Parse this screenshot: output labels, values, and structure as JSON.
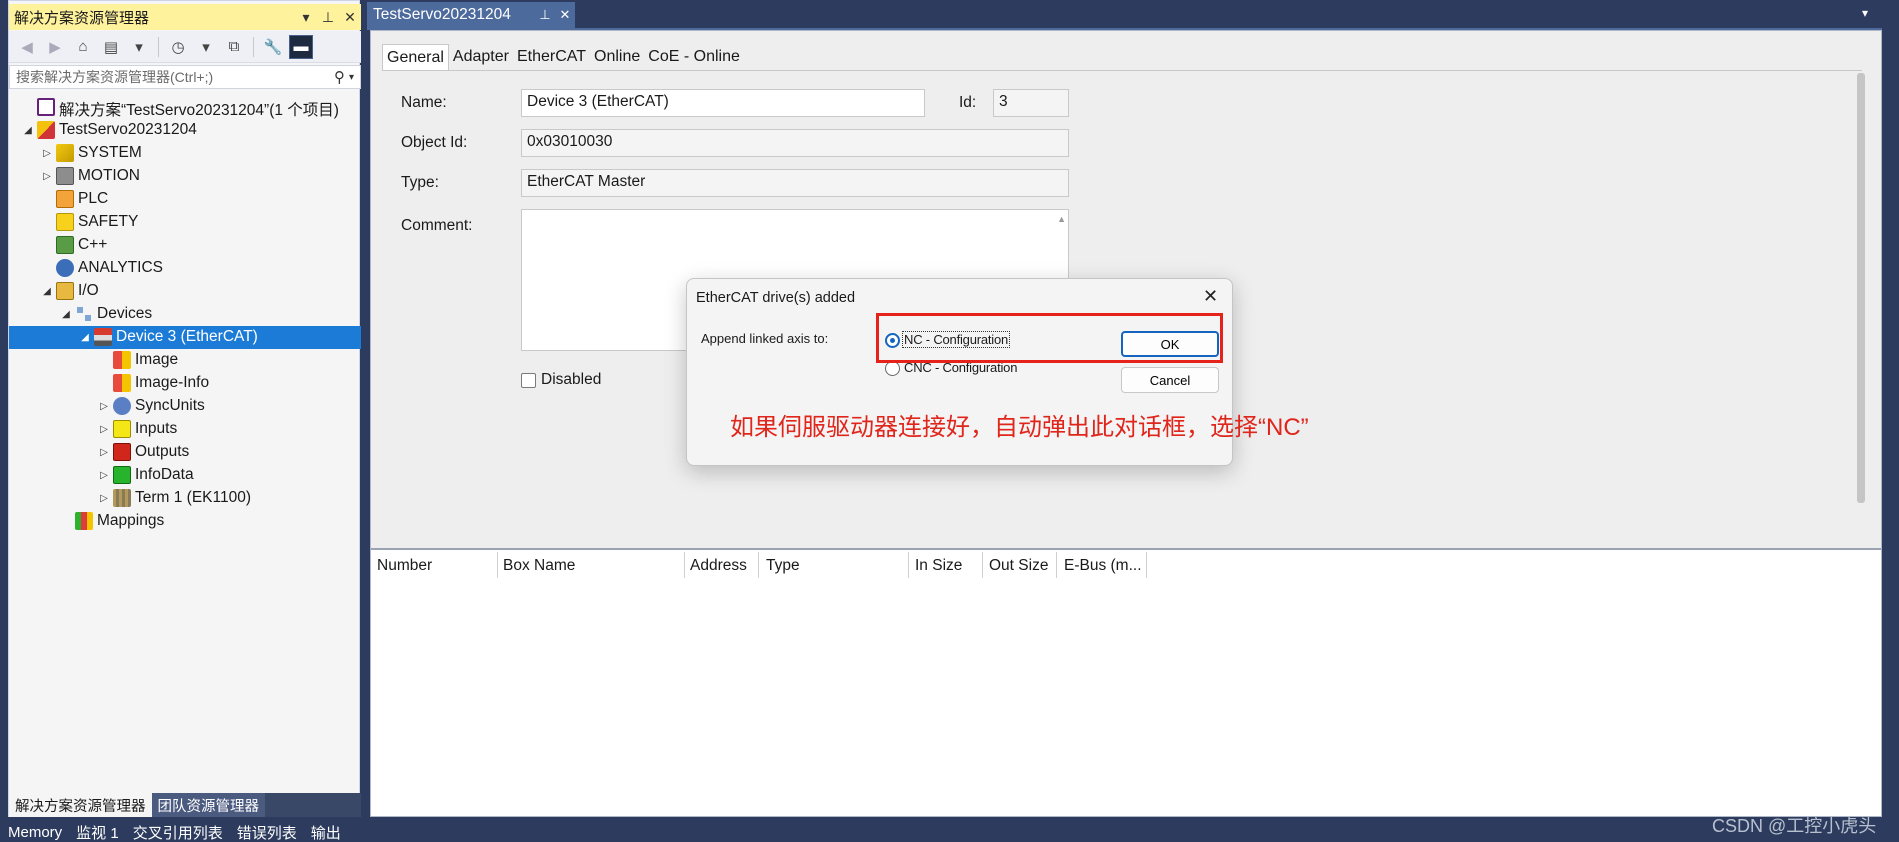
{
  "solution_explorer": {
    "title": "解决方案资源管理器",
    "title_buttons": {
      "dropdown": "▾",
      "pin": "⊥",
      "close": "✕"
    },
    "search_placeholder": "搜索解决方案资源管理器(Ctrl+;)",
    "tree": [
      {
        "label": "解决方案“TestServo20231204”(1 个项目)",
        "icon": "solution-icon",
        "icon_class": "ico-solution",
        "level": 0,
        "expander": ""
      },
      {
        "label": "TestServo20231204",
        "icon": "project-icon",
        "icon_class": "ico-project",
        "level": 0,
        "expander": "◢"
      },
      {
        "label": "SYSTEM",
        "icon": "system-icon",
        "icon_class": "ico-system",
        "level": 1,
        "expander": "▷"
      },
      {
        "label": "MOTION",
        "icon": "motion-icon",
        "icon_class": "ico-motion",
        "level": 1,
        "expander": "▷"
      },
      {
        "label": "PLC",
        "icon": "plc-icon",
        "icon_class": "ico-plc",
        "level": 1,
        "expander": ""
      },
      {
        "label": "SAFETY",
        "icon": "safety-icon",
        "icon_class": "ico-safety",
        "level": 1,
        "expander": ""
      },
      {
        "label": "C++",
        "icon": "cpp-icon",
        "icon_class": "ico-cpp",
        "level": 1,
        "expander": ""
      },
      {
        "label": "ANALYTICS",
        "icon": "analytics-icon",
        "icon_class": "ico-analytics",
        "level": 1,
        "expander": ""
      },
      {
        "label": "I/O",
        "icon": "io-icon",
        "icon_class": "ico-io",
        "level": 1,
        "expander": "◢"
      },
      {
        "label": "Devices",
        "icon": "devices-icon",
        "icon_class": "ico-devices",
        "level": 2,
        "expander": "◢"
      },
      {
        "label": "Device 3 (EtherCAT)",
        "icon": "ethercat-device-icon",
        "icon_class": "ico-ethercat",
        "level": 3,
        "expander": "◢",
        "selected": true
      },
      {
        "label": "Image",
        "icon": "image-icon",
        "icon_class": "ico-image",
        "level": 4,
        "expander": ""
      },
      {
        "label": "Image-Info",
        "icon": "image-info-icon",
        "icon_class": "ico-image",
        "level": 4,
        "expander": ""
      },
      {
        "label": "SyncUnits",
        "icon": "sync-units-icon",
        "icon_class": "ico-sync",
        "level": 4,
        "expander": "▷"
      },
      {
        "label": "Inputs",
        "icon": "inputs-icon",
        "icon_class": "ico-inputs",
        "level": 4,
        "expander": "▷"
      },
      {
        "label": "Outputs",
        "icon": "outputs-icon",
        "icon_class": "ico-outputs",
        "level": 4,
        "expander": "▷"
      },
      {
        "label": "InfoData",
        "icon": "infodata-icon",
        "icon_class": "ico-infodata",
        "level": 4,
        "expander": "▷"
      },
      {
        "label": "Term 1 (EK1100)",
        "icon": "terminal-icon",
        "icon_class": "ico-term",
        "level": 4,
        "expander": "▷"
      },
      {
        "label": "Mappings",
        "icon": "mappings-icon",
        "icon_class": "ico-mappings",
        "level": 2,
        "expander": ""
      }
    ],
    "bottom_tabs": [
      "解决方案资源管理器",
      "团队资源管理器"
    ]
  },
  "status_bar": [
    "Memory",
    "监视 1",
    "交叉引用列表",
    "错误列表",
    "输出"
  ],
  "document_tab": {
    "title": "TestServo20231204",
    "pin": "⊥",
    "close": "✕"
  },
  "property_tabs": [
    "General",
    "Adapter",
    "EtherCAT",
    "Online",
    "CoE - Online"
  ],
  "general": {
    "name_label": "Name:",
    "name_value": "Device 3 (EtherCAT)",
    "id_label": "Id:",
    "id_value": "3",
    "object_id_label": "Object Id:",
    "object_id_value": "0x03010030",
    "type_label": "Type:",
    "type_value": "EtherCAT Master",
    "comment_label": "Comment:",
    "disabled_label": "Disabled"
  },
  "list_columns": [
    "Number",
    "Box Name",
    "Address",
    "Type",
    "In Size",
    "Out Size",
    "E-Bus (m..."
  ],
  "dialog": {
    "title": "EtherCAT drive(s) added",
    "close": "✕",
    "append_label": "Append linked axis to:",
    "options": [
      {
        "label": "NC - Configuration",
        "checked": true
      },
      {
        "label": "CNC - Configuration",
        "checked": false
      }
    ],
    "ok_label": "OK",
    "cancel_label": "Cancel"
  },
  "annotation_text": "如果伺服驱动器连接好，自动弹出此对话框，选择“NC”",
  "watermark": "CSDN @工控小虎头",
  "colors": {
    "selection": "#1c7bd6",
    "title_bar_active": "#fff29d",
    "ide_frame": "#2d3c5e",
    "annotation_red": "#e0251b"
  }
}
